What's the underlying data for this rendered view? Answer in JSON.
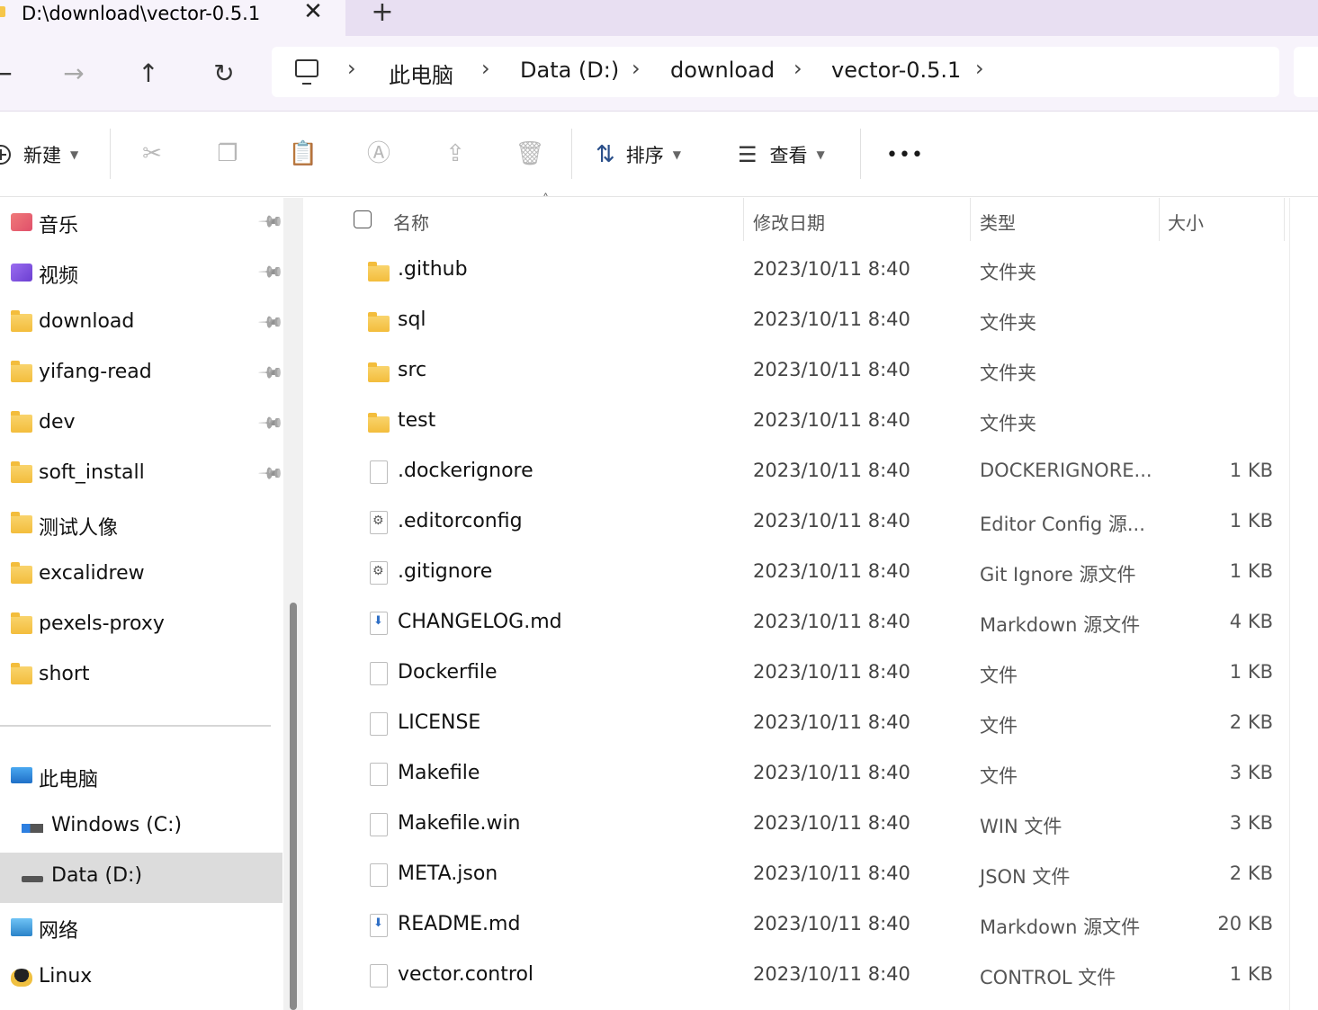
{
  "tab": {
    "title": "D:\\download\\vector-0.5.1",
    "close": "✕",
    "new": "+"
  },
  "nav": {
    "back": "←",
    "forward": "→",
    "up": "↑",
    "refresh": "↻",
    "breadcrumbs": [
      "此电脑",
      "Data (D:)",
      "download",
      "vector-0.5.1"
    ],
    "separator": "›"
  },
  "commands": {
    "new_label": "新建",
    "sort_label": "排序",
    "view_label": "查看",
    "more": "•••",
    "icons": [
      "cut-icon",
      "copy-icon",
      "paste-icon",
      "rename-icon",
      "share-icon",
      "delete-icon"
    ]
  },
  "sidebar": {
    "quick_access": [
      {
        "label": "音乐",
        "icon": "music-folder-icon",
        "pinned": true
      },
      {
        "label": "视频",
        "icon": "video-folder-icon",
        "pinned": true
      },
      {
        "label": "download",
        "icon": "folder-icon",
        "pinned": true
      },
      {
        "label": "yifang-read",
        "icon": "folder-icon",
        "pinned": true
      },
      {
        "label": "dev",
        "icon": "folder-icon",
        "pinned": true
      },
      {
        "label": "soft_install",
        "icon": "folder-icon",
        "pinned": true
      },
      {
        "label": "测试人像",
        "icon": "folder-icon",
        "pinned": false
      },
      {
        "label": "excalidrew",
        "icon": "folder-icon",
        "pinned": false
      },
      {
        "label": "pexels-proxy",
        "icon": "folder-icon",
        "pinned": false
      },
      {
        "label": "short",
        "icon": "folder-icon",
        "pinned": false
      }
    ],
    "this_pc": "此电脑",
    "drives": [
      {
        "label": "Windows (C:)",
        "selected": false
      },
      {
        "label": "Data (D:)",
        "selected": true
      }
    ],
    "network": "网络",
    "linux": "Linux"
  },
  "columns": {
    "name": "名称",
    "date": "修改日期",
    "type": "类型",
    "size": "大小"
  },
  "files": [
    {
      "name": ".github",
      "date": "2023/10/11 8:40",
      "type": "文件夹",
      "size": "",
      "kind": "folder"
    },
    {
      "name": "sql",
      "date": "2023/10/11 8:40",
      "type": "文件夹",
      "size": "",
      "kind": "folder"
    },
    {
      "name": "src",
      "date": "2023/10/11 8:40",
      "type": "文件夹",
      "size": "",
      "kind": "folder"
    },
    {
      "name": "test",
      "date": "2023/10/11 8:40",
      "type": "文件夹",
      "size": "",
      "kind": "folder"
    },
    {
      "name": ".dockerignore",
      "date": "2023/10/11 8:40",
      "type": "DOCKERIGNORE...",
      "size": "1 KB",
      "kind": "file"
    },
    {
      "name": ".editorconfig",
      "date": "2023/10/11 8:40",
      "type": "Editor Config 源...",
      "size": "1 KB",
      "kind": "cfg"
    },
    {
      "name": ".gitignore",
      "date": "2023/10/11 8:40",
      "type": "Git Ignore 源文件",
      "size": "1 KB",
      "kind": "cfg"
    },
    {
      "name": "CHANGELOG.md",
      "date": "2023/10/11 8:40",
      "type": "Markdown 源文件",
      "size": "4 KB",
      "kind": "md"
    },
    {
      "name": "Dockerfile",
      "date": "2023/10/11 8:40",
      "type": "文件",
      "size": "1 KB",
      "kind": "file"
    },
    {
      "name": "LICENSE",
      "date": "2023/10/11 8:40",
      "type": "文件",
      "size": "2 KB",
      "kind": "file"
    },
    {
      "name": "Makefile",
      "date": "2023/10/11 8:40",
      "type": "文件",
      "size": "3 KB",
      "kind": "file"
    },
    {
      "name": "Makefile.win",
      "date": "2023/10/11 8:40",
      "type": "WIN 文件",
      "size": "3 KB",
      "kind": "file"
    },
    {
      "name": "META.json",
      "date": "2023/10/11 8:40",
      "type": "JSON 文件",
      "size": "2 KB",
      "kind": "file"
    },
    {
      "name": "README.md",
      "date": "2023/10/11 8:40",
      "type": "Markdown 源文件",
      "size": "20 KB",
      "kind": "md"
    },
    {
      "name": "vector.control",
      "date": "2023/10/11 8:40",
      "type": "CONTROL 文件",
      "size": "1 KB",
      "kind": "file"
    }
  ]
}
